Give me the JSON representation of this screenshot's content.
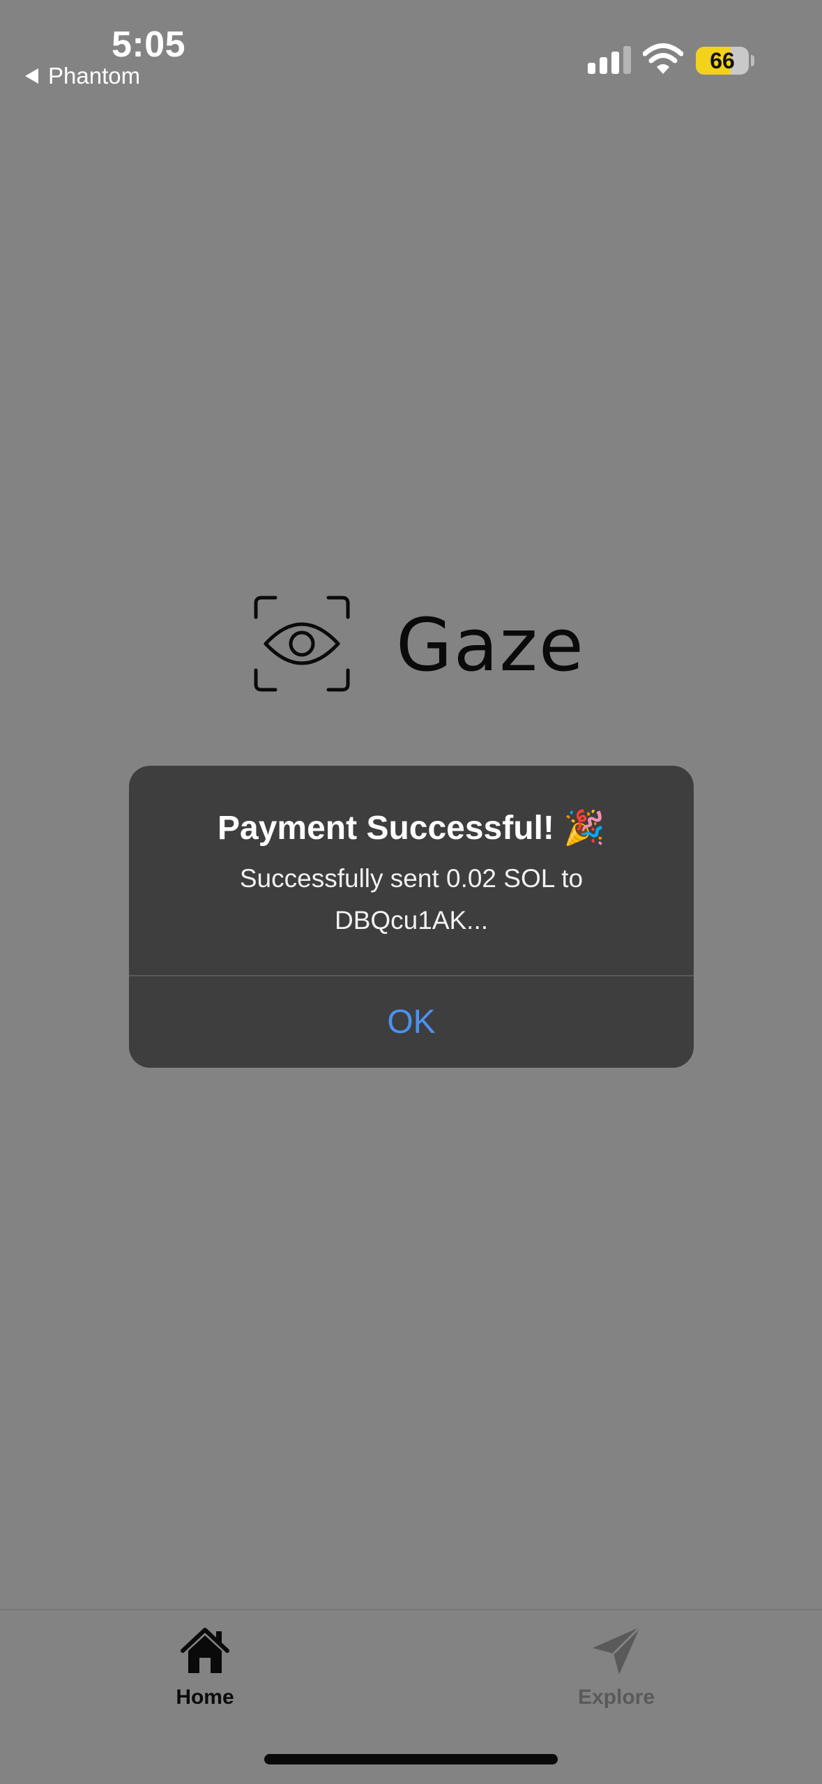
{
  "status_bar": {
    "time": "5:05",
    "back_app_label": "Phantom",
    "battery_level": "66",
    "battery_fraction": 0.66
  },
  "logo": {
    "name": "Gaze",
    "icon": "eye-scan-icon"
  },
  "alert": {
    "title": "Payment Successful! 🎉",
    "message": "Successfully sent 0.02 SOL to DBQcu1AK...",
    "ok_label": "OK"
  },
  "tab_bar": {
    "tabs": [
      {
        "label": "Home",
        "icon": "home-icon",
        "active": true
      },
      {
        "label": "Explore",
        "icon": "paper-plane-icon",
        "active": false
      }
    ]
  },
  "colors": {
    "background": "#838383",
    "alert_background": "#3e3e3e",
    "link_blue": "#4a92f2",
    "battery_yellow": "#f2d21b"
  }
}
